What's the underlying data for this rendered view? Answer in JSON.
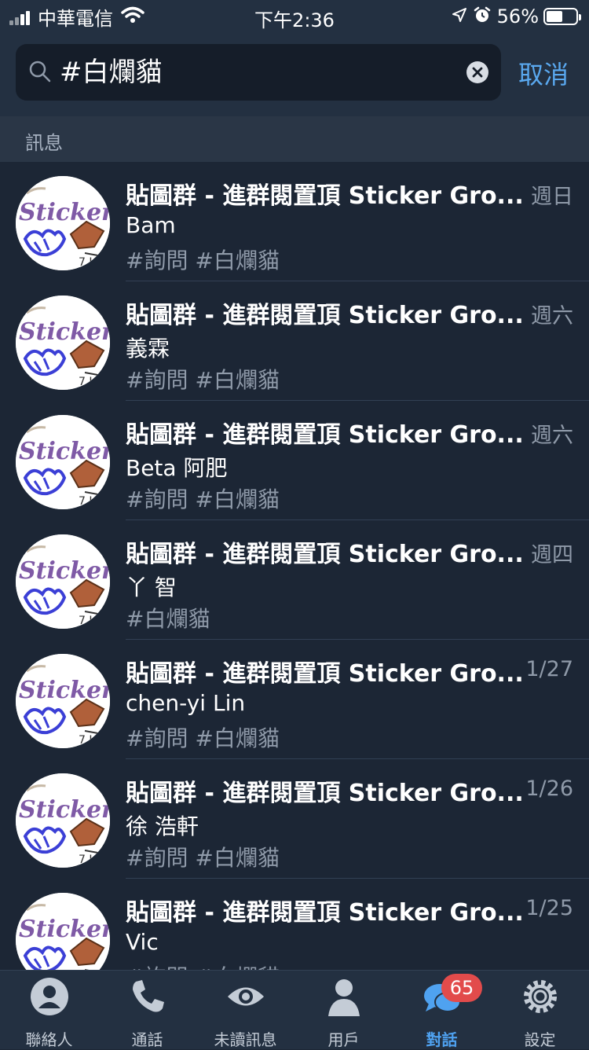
{
  "status_bar": {
    "carrier": "中華電信",
    "time": "下午2:36",
    "battery": "56%",
    "battery_level": 0.56
  },
  "search": {
    "value": "#白爛貓",
    "cancel_label": "取消"
  },
  "section_header": "訊息",
  "results": [
    {
      "title": "貼圖群 - 進群閱置頂 Sticker Gro...",
      "date": "週日",
      "sender": "Bam",
      "tags": "#詢問 #白爛貓"
    },
    {
      "title": "貼圖群 - 進群閱置頂 Sticker Gro...",
      "date": "週六",
      "sender": "義霖",
      "tags": "#詢問 #白爛貓"
    },
    {
      "title": "貼圖群 - 進群閱置頂 Sticker Gro...",
      "date": "週六",
      "sender": "Beta 阿肥",
      "tags": "#詢問 #白爛貓"
    },
    {
      "title": "貼圖群 - 進群閱置頂 Sticker Gro...",
      "date": "週四",
      "sender": "丫 智",
      "tags": "#白爛貓"
    },
    {
      "title": "貼圖群 - 進群閱置頂 Sticker Gro...",
      "date": "1/27",
      "sender": "chen-yi Lin",
      "tags": "#詢問 #白爛貓"
    },
    {
      "title": "貼圖群 - 進群閱置頂 Sticker Gro...",
      "date": "1/26",
      "sender": "徐 浩軒",
      "tags": "#詢問 #白爛貓"
    },
    {
      "title": "貼圖群 - 進群閱置頂 Sticker Gro...",
      "date": "1/25",
      "sender": "Vic",
      "tags": "#詢問 #白爛貓"
    }
  ],
  "avatar_text": "Stickers",
  "tabs": [
    {
      "label": "聯絡人",
      "icon": "contacts-icon"
    },
    {
      "label": "通話",
      "icon": "phone-icon"
    },
    {
      "label": "未讀訊息",
      "icon": "eye-icon"
    },
    {
      "label": "用戶",
      "icon": "user-icon"
    },
    {
      "label": "對話",
      "icon": "chats-icon",
      "badge": "65",
      "active": true
    },
    {
      "label": "設定",
      "icon": "settings-icon"
    }
  ],
  "colors": {
    "accent": "#4fa2f0",
    "background": "#1c2635",
    "badge": "#e24b4b"
  }
}
